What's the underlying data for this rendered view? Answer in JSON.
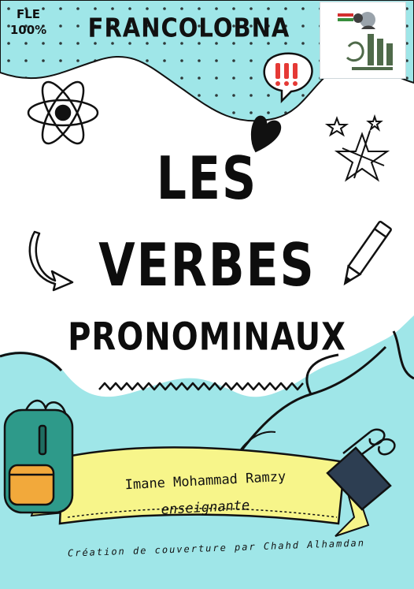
{
  "header": {
    "level_tag_line1": "FLE",
    "level_tag_line2": "100%",
    "brand": "FRANCOLOBNA"
  },
  "title": {
    "line1": "LES",
    "line2": "VERBES",
    "line3": "PRONOMINAUX"
  },
  "ribbon": {
    "author_name": "Imane Mohammad Ramzy",
    "author_role": "enseignante"
  },
  "credit": "Création de couverture par Chahd Alhamdan",
  "colors": {
    "accent_cyan": "#9fe6e8",
    "ribbon_yellow": "#f7f58a",
    "backpack_teal": "#2e9a8a",
    "pocket_orange": "#f2a93b",
    "clip_navy": "#2d3e52"
  },
  "icons": [
    "atom-icon",
    "speech-bubble-exclamation-icon",
    "heart-icon",
    "stars-icon",
    "curved-arrow-icon",
    "pencil-icon",
    "backpack-icon",
    "binder-clip-icon",
    "zigzag-line",
    "publisher-logo"
  ]
}
